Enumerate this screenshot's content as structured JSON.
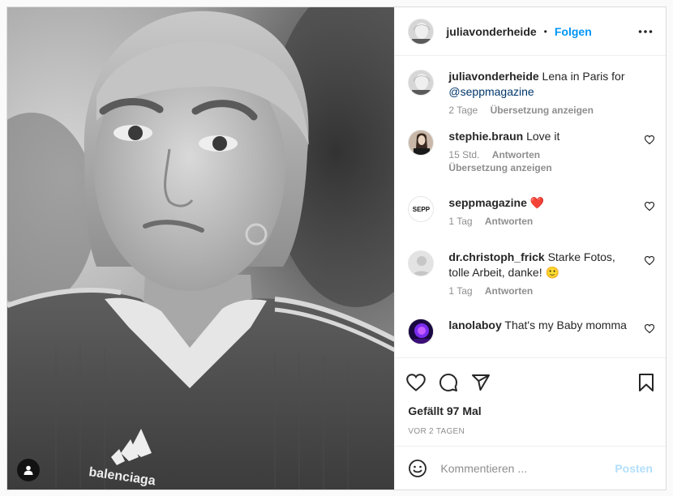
{
  "post": {
    "author": "juliavonderheide",
    "follow_label": "Folgen",
    "separator": "•",
    "caption": {
      "text": "Lena in Paris for",
      "mention": "@seppmagazine",
      "time": "2 Tage",
      "translate": "Übersetzung anzeigen"
    },
    "shirt_logo_text": "balenciaga"
  },
  "comments": [
    {
      "user": "stephie.braun",
      "text": "Love it",
      "time": "15 Std.",
      "reply": "Antworten",
      "translate": "Übersetzung anzeigen"
    },
    {
      "user": "seppmagazine",
      "text": "❤️",
      "time": "1 Tag",
      "reply": "Antworten",
      "avatar_text": "SEPP"
    },
    {
      "user": "dr.christoph_frick",
      "text": "Starke Fotos, tolle Arbeit, danke! 🙂",
      "time": "1 Tag",
      "reply": "Antworten"
    },
    {
      "user": "lanolaboy",
      "text": "That's my Baby momma"
    }
  ],
  "likes": "Gefällt 97 Mal",
  "age": "VOR 2 TAGEN",
  "composer": {
    "placeholder": "Kommentieren ...",
    "post_label": "Posten"
  },
  "colors": {
    "link": "#00376b",
    "follow": "#0095f6",
    "post_disabled": "#b2dffc",
    "meta": "#8e8e8e"
  },
  "icons": [
    "user-tag-icon",
    "more-icon",
    "heart-icon",
    "comment-icon",
    "share-icon",
    "bookmark-icon",
    "emoji-icon"
  ]
}
